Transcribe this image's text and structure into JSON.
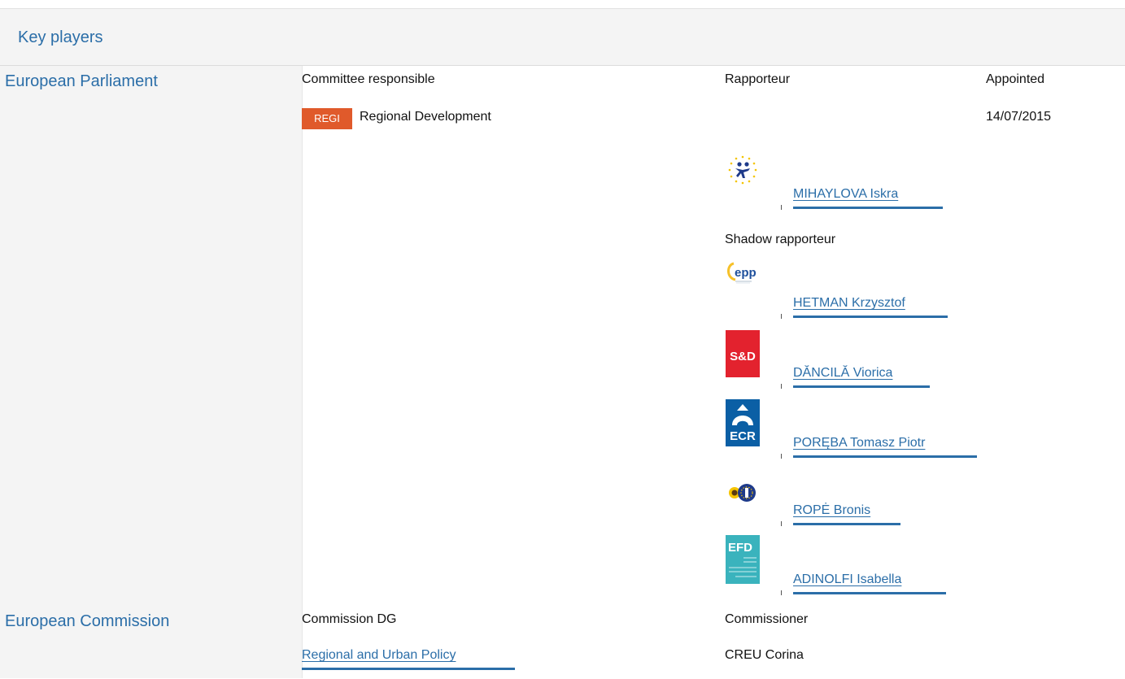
{
  "header": {
    "title": "Key players"
  },
  "parliament": {
    "name": "European Parliament",
    "col_committee": "Committee responsible",
    "col_rapporteur": "Rapporteur",
    "col_appointed": "Appointed",
    "committee_code": "REGI",
    "committee_name": "Regional Development",
    "appointed_date": "14/07/2015",
    "rapporteur": {
      "name": "MIHAYLOVA Iskra",
      "group_logo": "alde-logo"
    },
    "shadow_label": "Shadow rapporteur",
    "shadows": [
      {
        "name": "HETMAN Krzysztof",
        "group_logo": "epp-logo",
        "logo_text": "epp"
      },
      {
        "name": "DĂNCILĂ Viorica",
        "group_logo": "sd-logo",
        "logo_text": "S&D"
      },
      {
        "name": "PORĘBA Tomasz Piotr",
        "group_logo": "ecr-logo",
        "logo_text": "ECR"
      },
      {
        "name": "ROPĖ Bronis",
        "group_logo": "greens-efa-logo"
      },
      {
        "name": "ADINOLFI Isabella",
        "group_logo": "efdd-logo",
        "logo_text": "EFD"
      }
    ]
  },
  "commission": {
    "name": "European Commission",
    "col_dg": "Commission DG",
    "col_commissioner": "Commissioner",
    "dg_name": "Regional and Urban Policy",
    "commissioner_name": "CREU Corina"
  },
  "colors": {
    "link": "#2b6ea8",
    "badge": "#e05a2b",
    "sd_red": "#e3222e",
    "ecr_blue": "#0b5fa5",
    "efdd_teal": "#3ab3bd"
  }
}
